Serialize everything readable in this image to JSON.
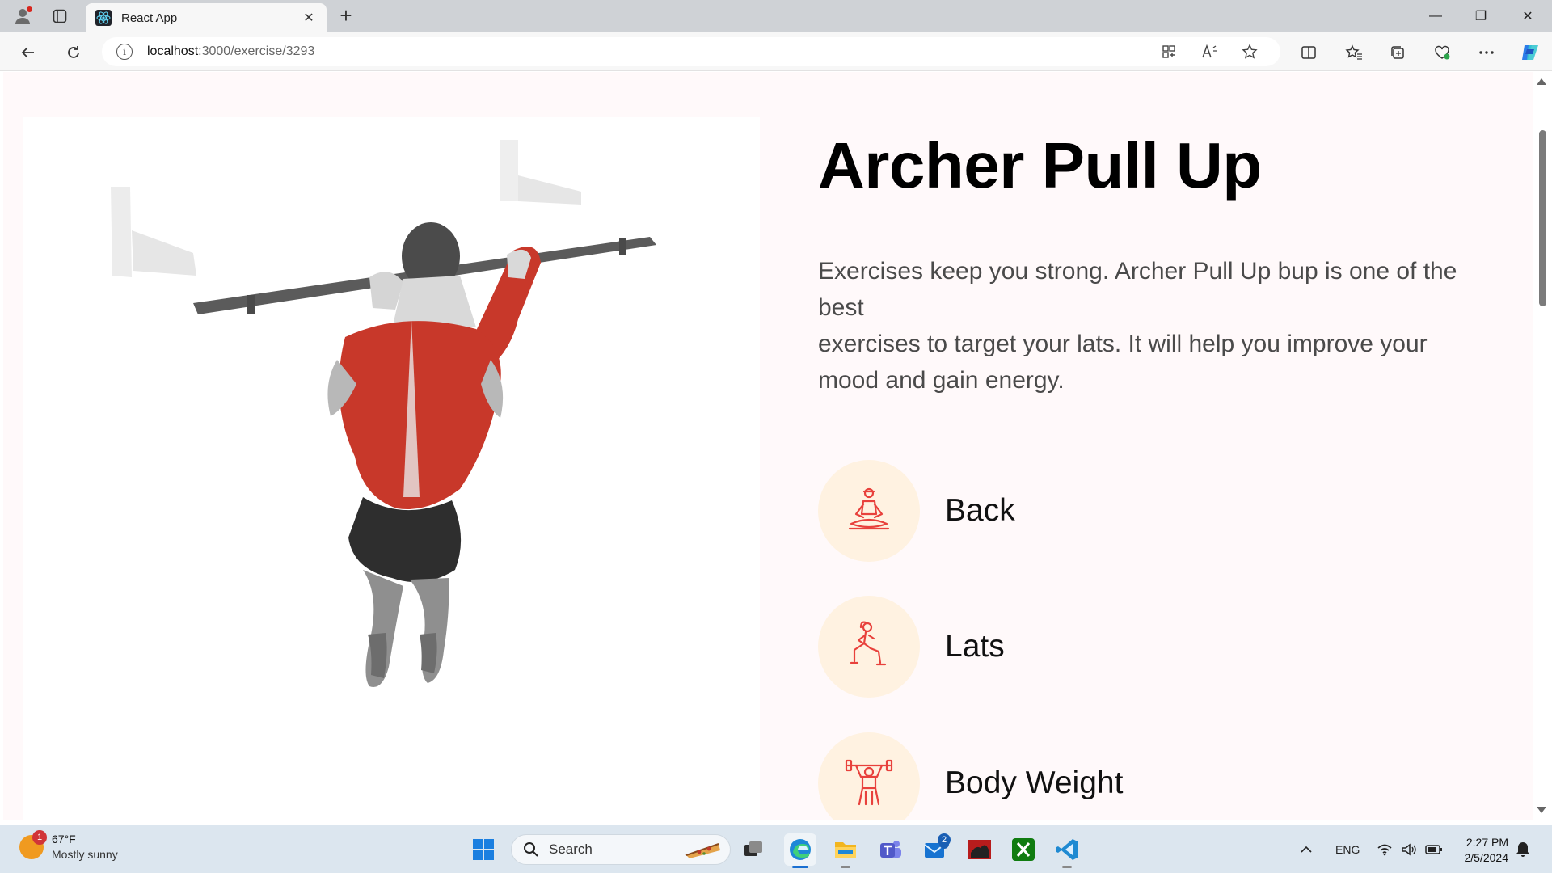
{
  "browser": {
    "tab_title": "React App",
    "tab_close": "✕",
    "new_tab": "+",
    "url_host": "localhost",
    "url_path": ":3000/exercise/3293",
    "info": "i",
    "window_min": "—",
    "window_max": "❐",
    "window_close": "✕"
  },
  "exercise": {
    "title": "Archer Pull Up",
    "description_lines": [
      "Exercises keep you strong. Archer Pull Up bup is one of the best",
      "exercises to target your lats. It will help you improve your mood and gain energy."
    ],
    "description_line_1a": "Exercises keep you strong. Archer Pull Up bup is one of the",
    "description_line_1b": "best",
    "description_line_2a": "exercises to target your lats. It will help you improve your",
    "description_line_2b": "mood and gain energy.",
    "tags": [
      {
        "label": "Back",
        "icon": "yoga-person-icon"
      },
      {
        "label": "Lats",
        "icon": "lunge-person-icon"
      },
      {
        "label": "Body Weight",
        "icon": "weightlifter-icon"
      }
    ]
  },
  "taskbar": {
    "weather_temp": "67°F",
    "weather_condition": "Mostly sunny",
    "weather_badge": "1",
    "search_label": "Search",
    "mail_badge": "2",
    "language": "ENG",
    "time": "2:27 PM",
    "date": "2/5/2024"
  },
  "colors": {
    "page_bg": "#fff9fa",
    "tag_circle": "#fff2e1",
    "tag_icon_stroke": "#e8413c",
    "muscle_red": "#c8382a"
  }
}
